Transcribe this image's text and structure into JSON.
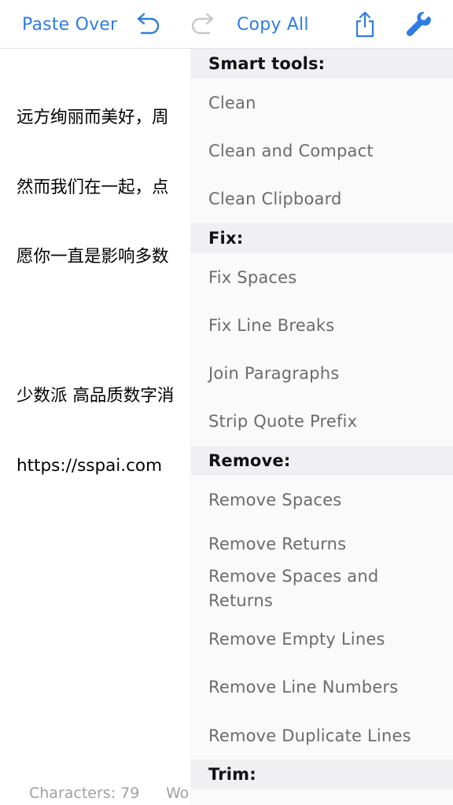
{
  "toolbar": {
    "paste_over": "Paste Over",
    "copy_all": "Copy All",
    "icons": [
      "undo-icon",
      "redo-icon",
      "share-icon",
      "wrench-icon"
    ],
    "accent_color": "#2f7de1"
  },
  "editor": {
    "lines": [
      "远方绚丽而美好，周",
      "然而我们在一起，点",
      "愿你一直是影响多数",
      "",
      "少数派 高品质数字消",
      "https://sspai.com"
    ]
  },
  "status": {
    "characters": "Characters: 79",
    "words": "Wo"
  },
  "menu": {
    "smart_tools": {
      "header": "Smart tools:",
      "items": [
        "Clean",
        "Clean and Compact",
        "Clean Clipboard"
      ]
    },
    "fix": {
      "header": "Fix:",
      "items": [
        "Fix Spaces",
        "Fix Line Breaks",
        "Join Paragraphs",
        "Strip Quote Prefix"
      ]
    },
    "remove": {
      "header": "Remove:",
      "items": [
        "Remove Spaces",
        "Remove Returns",
        "Remove Spaces and Returns",
        "Remove Empty Lines",
        "Remove Line Numbers",
        "Remove Duplicate Lines"
      ]
    },
    "trim": {
      "header": "Trim:"
    }
  }
}
